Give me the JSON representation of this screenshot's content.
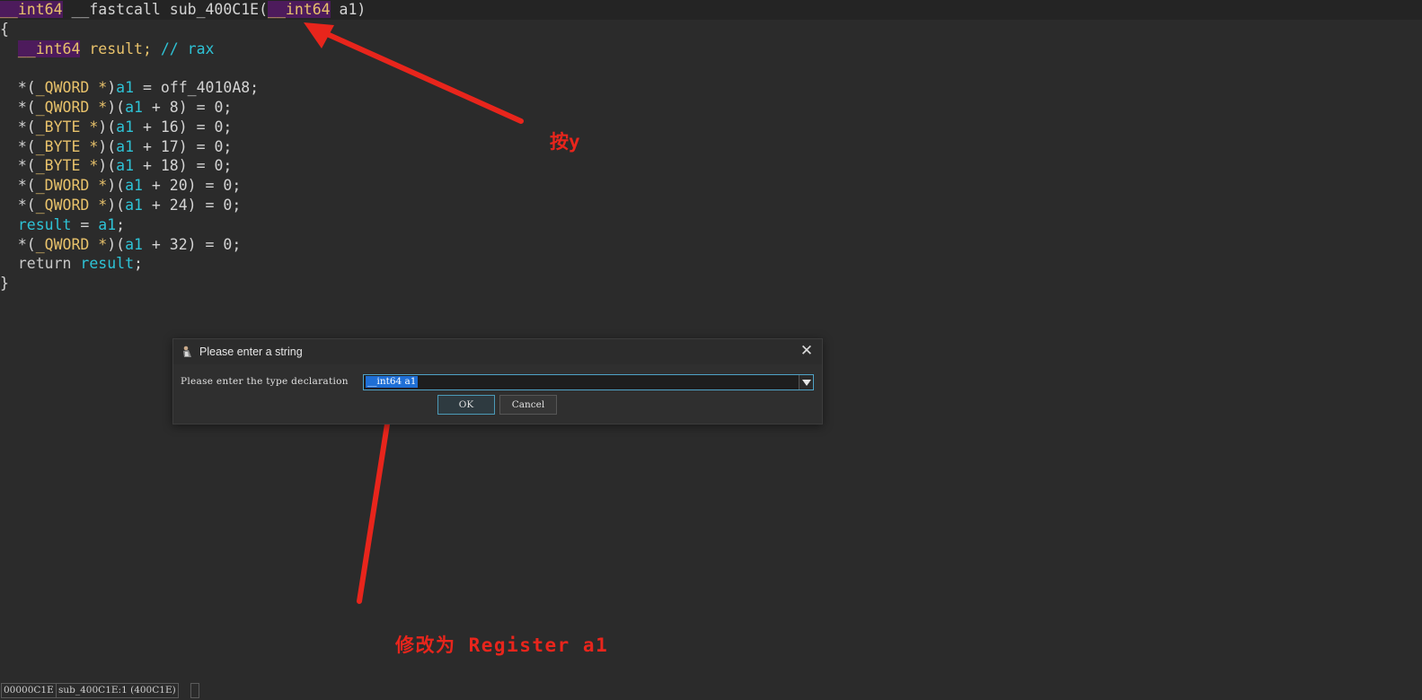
{
  "code": {
    "sig": {
      "ret_type": "__int64",
      "callconv": " __fastcall ",
      "func_name": "sub_400C1E",
      "open_paren": "(",
      "param_type": "__int64",
      "param_name": " a1",
      "close_paren": ")"
    },
    "lines": {
      "open_brace": "{",
      "decl_indent": "  ",
      "decl_type": "__int64",
      "decl_name": " result; ",
      "decl_comment": "// rax",
      "close_brace": "}"
    },
    "stmts": [
      {
        "pre": "  *(",
        "type": "_QWORD *",
        "mid": ")",
        "var": "a1",
        "rest": " = off_4010A8;"
      },
      {
        "pre": "  *(",
        "type": "_QWORD *",
        "mid": ")(",
        "var": "a1",
        "rest": " + 8) = 0;"
      },
      {
        "pre": "  *(",
        "type": "_BYTE *",
        "mid": ")(",
        "var": "a1",
        "rest": " + 16) = 0;"
      },
      {
        "pre": "  *(",
        "type": "_BYTE *",
        "mid": ")(",
        "var": "a1",
        "rest": " + 17) = 0;"
      },
      {
        "pre": "  *(",
        "type": "_BYTE *",
        "mid": ")(",
        "var": "a1",
        "rest": " + 18) = 0;"
      },
      {
        "pre": "  *(",
        "type": "_DWORD *",
        "mid": ")(",
        "var": "a1",
        "rest": " + 20) = 0;"
      },
      {
        "pre": "  *(",
        "type": "_QWORD *",
        "mid": ")(",
        "var": "a1",
        "rest": " + 24) = 0;"
      }
    ],
    "assign": {
      "indent": "  ",
      "lhs": "result",
      "op": " = ",
      "rhs": "a1",
      "end": ";"
    },
    "stmt_last": {
      "pre": "  *(",
      "type": "_QWORD *",
      "mid": ")(",
      "var": "a1",
      "rest": " + 32) = 0;"
    },
    "ret": {
      "indent": "  ",
      "kw": "return ",
      "var": "result",
      "end": ";"
    }
  },
  "dialog": {
    "title": "Please enter a string",
    "close_glyph": "✕",
    "label": "Please enter the type declaration",
    "value": "__int64 a1",
    "ok_label": "OK",
    "cancel_label": "Cancel"
  },
  "annotations": {
    "press_y": "按y",
    "change_to": "修改为 Register a1",
    "color": "#e8251c"
  },
  "status_bar": {
    "address": "00000C1E",
    "location": "sub_400C1E:1 (400C1E)"
  },
  "colors": {
    "background": "#2b2b2b",
    "type_yellow": "#e8c26b",
    "var_cyan": "#2ec3d6",
    "type_highlight": "#4d1b5c",
    "selection_blue": "#1f6fd6"
  }
}
